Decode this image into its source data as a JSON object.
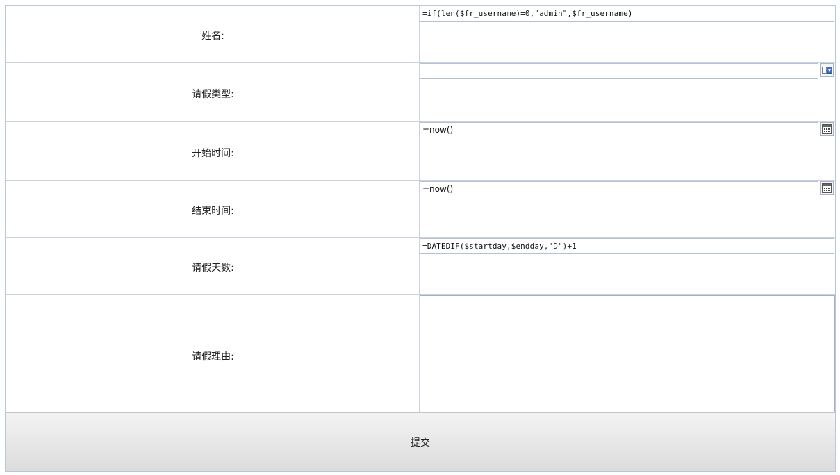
{
  "form": {
    "rows": [
      {
        "label": "姓名:",
        "value": "=if(len($fr_username)=0,\"admin\",$fr_username)"
      },
      {
        "label": "请假类型:",
        "value": ""
      },
      {
        "label": "开始时间:",
        "value": "=now()"
      },
      {
        "label": "结束时间:",
        "value": "=now()"
      },
      {
        "label": "请假天数:",
        "value": "=DATEDIF($startday,$endday,\"D\")+1"
      },
      {
        "label": "请假理由:",
        "value": ""
      }
    ],
    "submit_label": "提交"
  },
  "icons": {
    "combo": "dropdown-arrow-icon",
    "date": "calendar-icon"
  }
}
